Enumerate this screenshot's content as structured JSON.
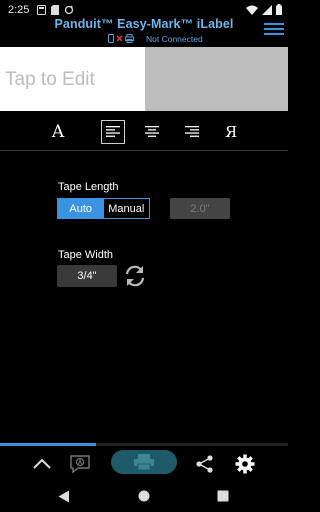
{
  "status_bar": {
    "time": "2:25",
    "left_icons": [
      "notification-icon",
      "sd-card-icon",
      "sync-icon"
    ],
    "right_icons": [
      "wifi-icon",
      "signal-icon",
      "battery-icon"
    ]
  },
  "app_bar": {
    "title": "Panduit™ Easy-Mark™ iLabel",
    "connection_status": "Not Connected",
    "menu_icon": "hamburger-menu-icon"
  },
  "label_preview": {
    "placeholder": "Tap to Edit"
  },
  "format_toolbar": {
    "font_glyph": "A",
    "rtl_glyph": "Я",
    "items": [
      "font-icon",
      "align-left-icon",
      "align-center-icon",
      "align-right-icon",
      "right-to-left-icon"
    ],
    "selected": "align-left-icon"
  },
  "tape_length": {
    "label": "Tape Length",
    "options": [
      "Auto",
      "Manual"
    ],
    "selected": "Auto",
    "value": "2.0\""
  },
  "tape_width": {
    "label": "Tape Width",
    "value": "3/4\"",
    "refresh_icon": "refresh-icon"
  },
  "bottom_toolbar": {
    "items": [
      "chevron-up-icon",
      "label-preview-icon",
      "print-icon",
      "share-icon",
      "settings-gear-icon"
    ]
  },
  "nav_bar": {
    "items": [
      "back-icon",
      "home-icon",
      "recents-icon"
    ]
  },
  "colors": {
    "accent": "#3a93e0",
    "title": "#6ab7f0",
    "print_button": "#1e5a68",
    "label_gray": "#bdbdbd"
  }
}
